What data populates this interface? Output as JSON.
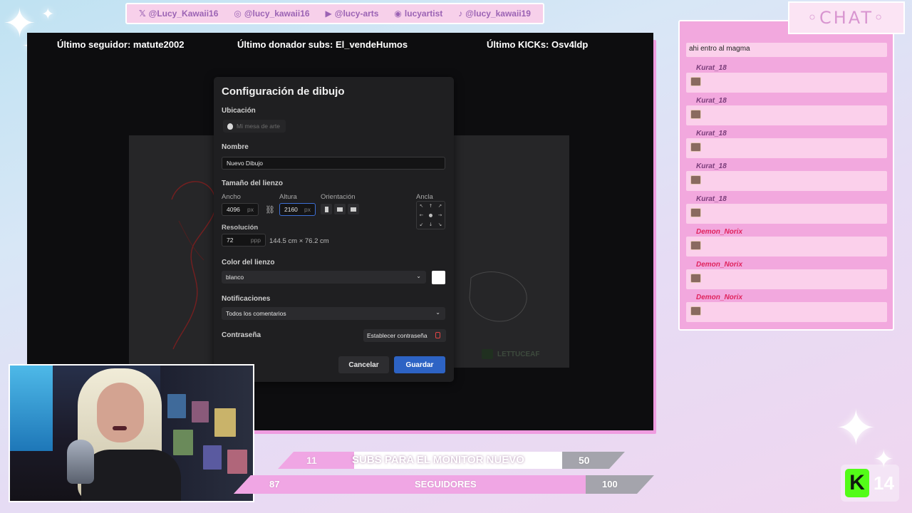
{
  "social": [
    {
      "icon": "x-logo-icon",
      "text": "@Lucy_Kawaii16"
    },
    {
      "icon": "instagram-icon",
      "text": "@lucy_kawaii16"
    },
    {
      "icon": "youtube-icon",
      "text": "@lucy-arts"
    },
    {
      "icon": "discord-icon",
      "text": "lucyartist"
    },
    {
      "icon": "tiktok-icon",
      "text": "@lucy_kawaii19"
    }
  ],
  "stream": {
    "last_follower": "Último seguidor: matute2002",
    "last_donor": "Último donador subs: El_vendeHumos",
    "last_kicks": "Último KICKs: Osv4ldp",
    "watermark": "LETTUCEAF"
  },
  "dialog": {
    "title": "Configuración de dibujo",
    "location_label": "Ubicación",
    "location_value": "Mi mesa de arte",
    "name_label": "Nombre",
    "name_value": "Nuevo Dibujo",
    "canvas_size_label": "Tamaño del lienzo",
    "width_label": "Ancho",
    "width_value": "4096",
    "height_label": "Altura",
    "height_value": "2160",
    "unit_px": "px",
    "orientation_label": "Orientación",
    "anchor_label": "Ancla",
    "resolution_label": "Resolución",
    "resolution_value": "72",
    "resolution_unit": "ppp",
    "print_size": "144.5 cm × 76.2 cm",
    "canvas_color_label": "Color del lienzo",
    "canvas_color_value": "blanco",
    "notifications_label": "Notificaciones",
    "notifications_value": "Todos los comentarios",
    "password_label": "Contraseña",
    "set_password_label": "Establecer contraseña",
    "cancel_label": "Cancelar",
    "save_label": "Guardar"
  },
  "goals": {
    "subs": {
      "current": "11",
      "label": "SUBS PARA EL MONITOR NUEVO",
      "target": "50",
      "progress": 0.22
    },
    "followers": {
      "current": "87",
      "label": "SEGUIDORES",
      "target": "100",
      "progress": 0.87
    }
  },
  "kick_badge": {
    "letter": "K",
    "count": "14"
  },
  "chat": {
    "title": "◦CHAT◦",
    "first_message": "ahi entro al magma",
    "messages": [
      {
        "user": "Kurat_18",
        "color": "#7a3d7a"
      },
      {
        "user": "Kurat_18",
        "color": "#7a3d7a"
      },
      {
        "user": "Kurat_18",
        "color": "#7a3d7a"
      },
      {
        "user": "Kurat_18",
        "color": "#7a3d7a"
      },
      {
        "user": "Kurat_18",
        "color": "#7a3d7a"
      },
      {
        "user": "Demon_Norix",
        "color": "#e0245e"
      },
      {
        "user": "Demon_Norix",
        "color": "#e0245e"
      },
      {
        "user": "Demon_Norix",
        "color": "#e0245e"
      }
    ]
  },
  "colors": {
    "accent_blue": "#2d63c4",
    "goal_pink": "#f0a6e4",
    "chat_panel": "#f2a8de"
  }
}
